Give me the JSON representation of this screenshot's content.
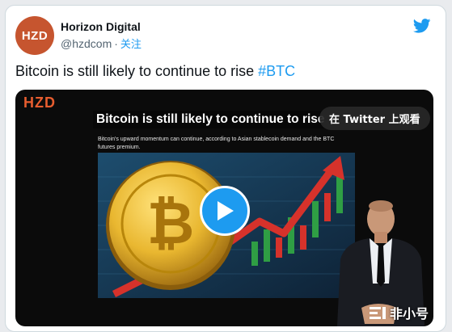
{
  "author": {
    "avatar_text": "HZD",
    "display_name": "Horizon Digital",
    "handle": "@hzdcom",
    "separator": "·",
    "follow_label": "关注"
  },
  "tweet": {
    "text": "Bitcoin is still likely to continue to rise ",
    "hashtag": "#BTC"
  },
  "media": {
    "brand": "HZD",
    "headline": "Bitcoin is still likely to continue to rise",
    "watch_on_twitter": "在 Twitter 上观看",
    "subtext": "Bitcoin's upward momentum can continue, according to Asian stablecoin demand and the BTC futures premium.",
    "coin_symbol": "₿",
    "watermark": "非小号"
  },
  "colors": {
    "twitter_blue": "#1d9bf0",
    "brand_orange": "#c6552f",
    "coin_gold": "#e9b730",
    "arrow_red": "#d6322b"
  },
  "icons": [
    "twitter-bird-icon",
    "play-icon",
    "watermark-logo-icon"
  ]
}
